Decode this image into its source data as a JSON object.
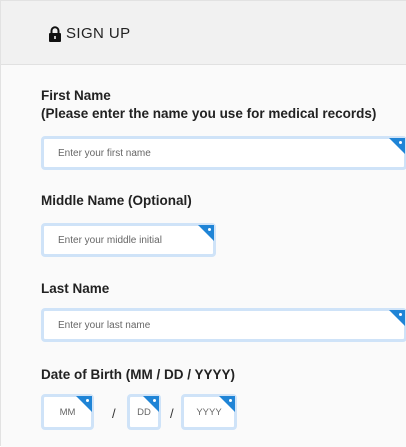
{
  "header": {
    "title": "SIGN UP"
  },
  "icons": {
    "lock": "lock-icon"
  },
  "first_name": {
    "label_line1": "First Name",
    "label_line2": "(Please enter the name you use for medical records)",
    "placeholder": "Enter your first name"
  },
  "middle_name": {
    "label": "Middle Name (Optional)",
    "placeholder": "Enter your middle initial"
  },
  "last_name": {
    "label": "Last Name",
    "placeholder": "Enter your last name"
  },
  "dob": {
    "label": "Date of Birth (MM / DD / YYYY)",
    "mm_placeholder": "MM",
    "dd_placeholder": "DD",
    "yyyy_placeholder": "YYYY",
    "separator": "/"
  },
  "colors": {
    "accent": "#1f84d6",
    "field_border": "#cfe3f8"
  }
}
